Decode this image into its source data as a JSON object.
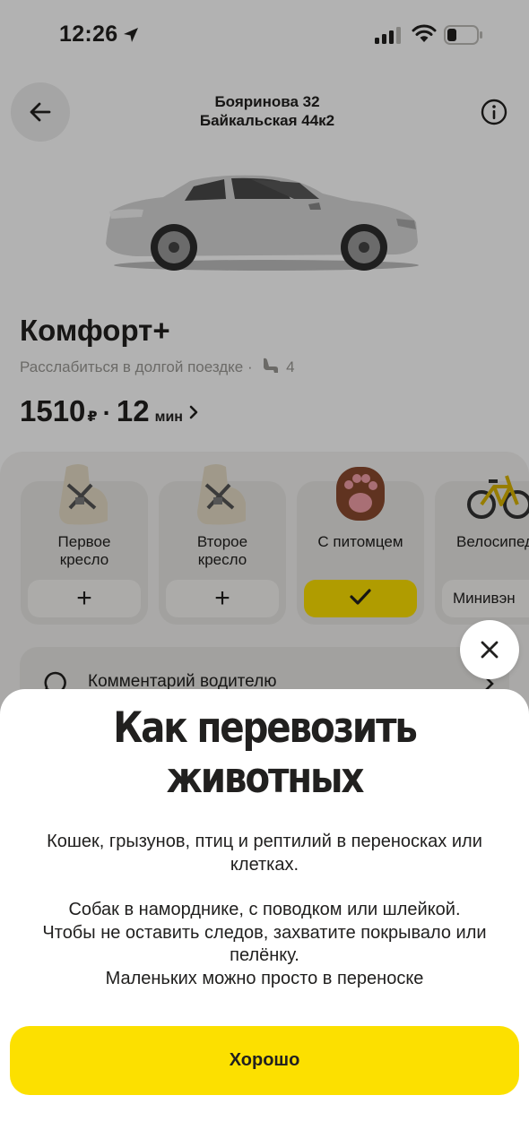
{
  "status_bar": {
    "time": "12:26"
  },
  "route": {
    "from": "Бояринова 32",
    "to": "Байкальская 44к2"
  },
  "tariff": {
    "name": "Комфорт+",
    "description": "Расслабиться в долгой поездке ·",
    "seats": "4",
    "price_value": "1510",
    "price_currency": "₽",
    "separator": "·",
    "eta_value": "12",
    "eta_unit": "мин"
  },
  "options": [
    {
      "label_line1": "Первое",
      "label_line2": "кресло",
      "action": "+"
    },
    {
      "label_line1": "Второе",
      "label_line2": "кресло",
      "action": "+"
    },
    {
      "label_line1": "С питомцем",
      "label_line2": "",
      "action": "✓"
    },
    {
      "label_line1": "Велосипед",
      "label_line2": "",
      "action": "Минивэн"
    }
  ],
  "comment": {
    "label": "Комментарий водителю"
  },
  "sheet": {
    "title_line1": "Как перевозить",
    "title_line2": "животных",
    "text_line1": "Кошек, грызунов, птиц и рептилий в переносках или",
    "text_line2": "клетках.",
    "text_line3": "Собак в наморднике, с поводком или шлейкой.",
    "text_line4": "Чтобы не оставить следов, захватите покрывало или",
    "text_line5": "пелёнку.",
    "text_line6": "Маленьких можно просто в переноске",
    "ok_label": "Хорошо"
  },
  "colors": {
    "accent_yellow": "#fce000",
    "text_primary": "#21201f",
    "text_secondary": "#9a9894",
    "overlay": "rgba(0,0,0,0.30)"
  },
  "icons": [
    "location-arrow-icon",
    "signal-icon",
    "wifi-icon",
    "battery-icon",
    "back-arrow-icon",
    "info-icon",
    "seat-icon",
    "plus-icon",
    "check-icon",
    "chat-bubble-icon",
    "chevron-right-icon",
    "close-icon"
  ]
}
